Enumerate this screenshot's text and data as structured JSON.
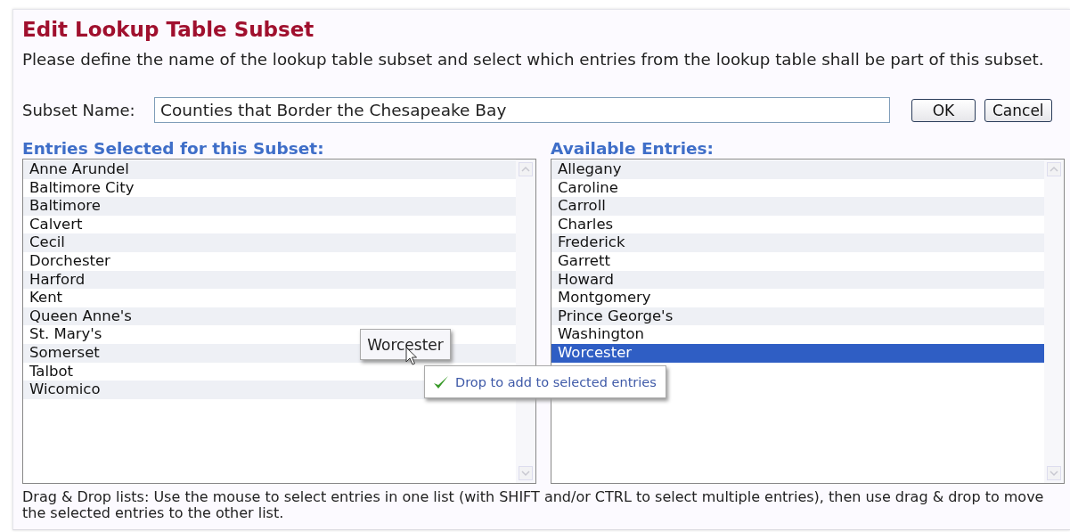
{
  "title": "Edit Lookup Table Subset",
  "description": "Please define the name of the lookup table subset and select which entries from the lookup table shall be part of this subset.",
  "subset_name": {
    "label": "Subset Name:",
    "value": "Counties that Border the Chesapeake Bay"
  },
  "buttons": [
    "OK",
    "Cancel"
  ],
  "lists": [
    {
      "heading": "Entries Selected for this Subset:",
      "items": [
        {
          "label": "Anne Arundel",
          "selected": false
        },
        {
          "label": "Baltimore City",
          "selected": false
        },
        {
          "label": "Baltimore",
          "selected": false
        },
        {
          "label": "Calvert",
          "selected": false
        },
        {
          "label": "Cecil",
          "selected": false
        },
        {
          "label": "Dorchester",
          "selected": false
        },
        {
          "label": "Harford",
          "selected": false
        },
        {
          "label": "Kent",
          "selected": false
        },
        {
          "label": "Queen Anne's",
          "selected": false
        },
        {
          "label": "St. Mary's",
          "selected": false
        },
        {
          "label": "Somerset",
          "selected": false
        },
        {
          "label": "Talbot",
          "selected": false
        },
        {
          "label": "Wicomico",
          "selected": false
        }
      ]
    },
    {
      "heading": "Available Entries:",
      "items": [
        {
          "label": "Allegany",
          "selected": false
        },
        {
          "label": "Caroline",
          "selected": false
        },
        {
          "label": "Carroll",
          "selected": false
        },
        {
          "label": "Charles",
          "selected": false
        },
        {
          "label": "Frederick",
          "selected": false
        },
        {
          "label": "Garrett",
          "selected": false
        },
        {
          "label": "Howard",
          "selected": false
        },
        {
          "label": "Montgomery",
          "selected": false
        },
        {
          "label": "Prince George's",
          "selected": false
        },
        {
          "label": "Washington",
          "selected": false
        },
        {
          "label": "Worcester",
          "selected": true
        }
      ]
    }
  ],
  "drag": {
    "ghost_label": "Worcester",
    "hint": "Drop to add to selected entries"
  },
  "help_text": "Drag & Drop lists: Use the mouse to select entries in one list (with SHIFT and/or CTRL to select multiple entries), then use drag & drop to move the selected entries to the other list."
}
